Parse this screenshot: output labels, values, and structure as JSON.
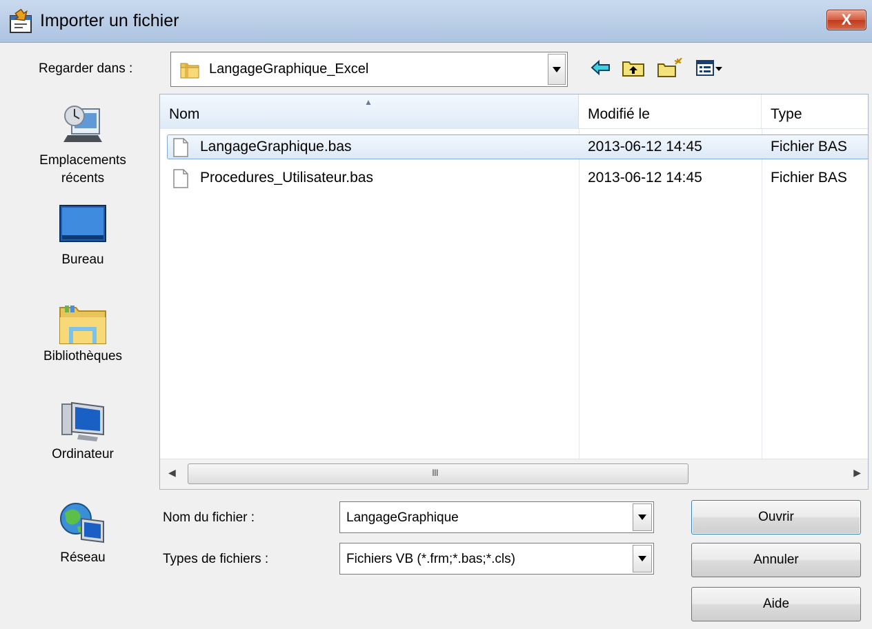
{
  "window": {
    "title": "Importer un fichier",
    "close_label": "X"
  },
  "look_in": {
    "label": "Regarder dans :",
    "value": "LangageGraphique_Excel"
  },
  "toolbar": {
    "icons": [
      "back-arrow-icon",
      "up-folder-icon",
      "new-folder-icon",
      "view-menu-icon"
    ]
  },
  "places": [
    {
      "label_line1": "Emplacements",
      "label_line2": "récents",
      "icon": "recent-places-icon"
    },
    {
      "label_line1": "Bureau",
      "icon": "desktop-icon"
    },
    {
      "label_line1": "Bibliothèques",
      "icon": "libraries-icon"
    },
    {
      "label_line1": "Ordinateur",
      "icon": "computer-icon"
    },
    {
      "label_line1": "Réseau",
      "icon": "network-icon"
    }
  ],
  "file_list": {
    "columns": [
      "Nom",
      "Modifié le",
      "Type"
    ],
    "rows": [
      {
        "name": "LangageGraphique.bas",
        "modified": "2013-06-12 14:45",
        "type": "Fichier BAS",
        "selected": true
      },
      {
        "name": "Procedures_Utilisateur.bas",
        "modified": "2013-06-12 14:45",
        "type": "Fichier BAS",
        "selected": false
      }
    ],
    "scroll_grip": "III"
  },
  "file_name": {
    "label": "Nom du fichier :",
    "value": "LangageGraphique"
  },
  "file_type": {
    "label": "Types de fichiers :",
    "value": "Fichiers VB (*.frm;*.bas;*.cls)"
  },
  "buttons": {
    "open": "Ouvrir",
    "cancel": "Annuler",
    "help": "Aide"
  },
  "colors": {
    "titlebar": "#b9cde6",
    "selection": "#dde9f7",
    "close_button": "#c9462a"
  }
}
